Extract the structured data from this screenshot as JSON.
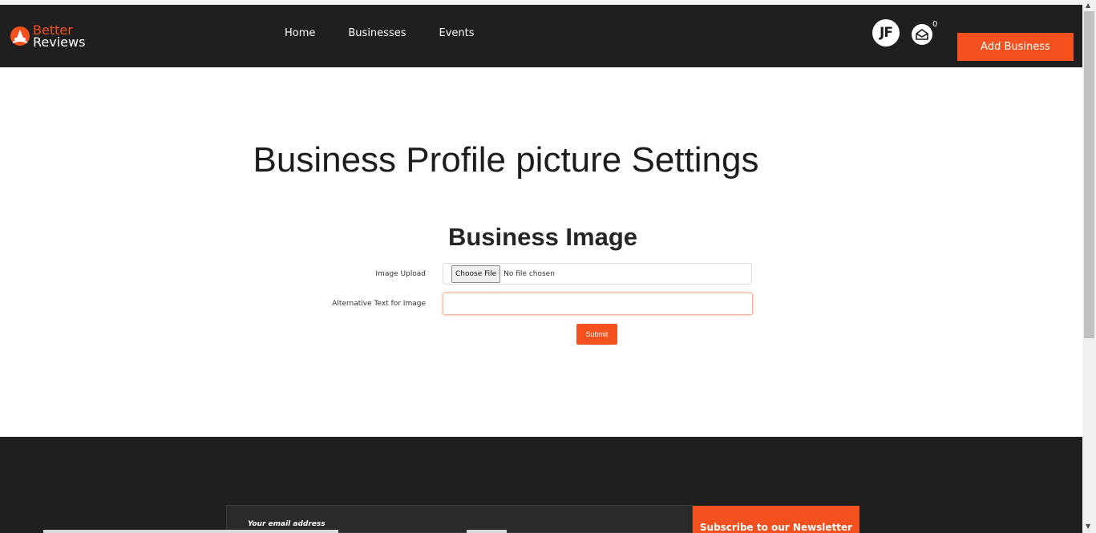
{
  "brand": {
    "line1": "Better",
    "line2": "Reviews",
    "icon": "better-reviews-logo-icon"
  },
  "nav": {
    "items": [
      {
        "label": "Home"
      },
      {
        "label": "Businesses"
      },
      {
        "label": "Events"
      }
    ]
  },
  "user": {
    "initials": "JF",
    "mail_icon": "envelope-icon",
    "mail_count": "0"
  },
  "header": {
    "add_business_label": "Add Business"
  },
  "main": {
    "title": "Business Profile picture Settings",
    "section_title": "Business Image",
    "image_upload_label": "Image Upload",
    "choose_file_label": "Choose File",
    "no_file_text": "No file chosen",
    "alt_text_label": "Alternative Text for Image",
    "alt_text_value": "",
    "submit_label": "Submit"
  },
  "footer": {
    "email_placeholder": "Your email address",
    "subscribe_label": "Subscribe to our Newsletter"
  },
  "colors": {
    "accent": "#f4511e",
    "dark": "#1f1f1f"
  }
}
